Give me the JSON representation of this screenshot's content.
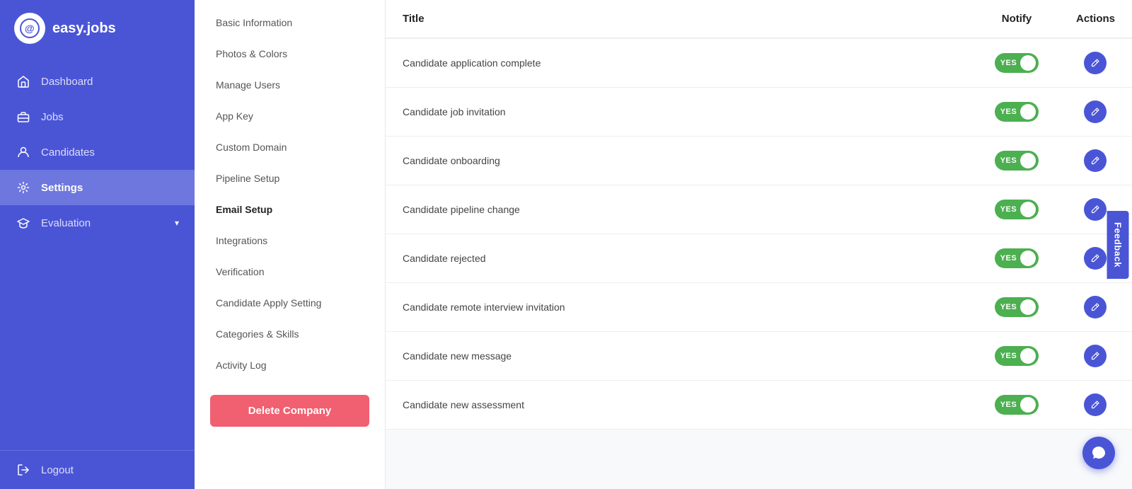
{
  "brand": {
    "logo_text": "easy.jobs",
    "logo_initial": "@"
  },
  "sidebar": {
    "items": [
      {
        "id": "dashboard",
        "label": "Dashboard",
        "icon": "home"
      },
      {
        "id": "jobs",
        "label": "Jobs",
        "icon": "briefcase"
      },
      {
        "id": "candidates",
        "label": "Candidates",
        "icon": "user"
      },
      {
        "id": "settings",
        "label": "Settings",
        "icon": "gear",
        "active": true
      },
      {
        "id": "evaluation",
        "label": "Evaluation",
        "icon": "graduation",
        "has_chevron": true
      }
    ],
    "logout_label": "Logout"
  },
  "submenu": {
    "items": [
      {
        "id": "basic-info",
        "label": "Basic Information"
      },
      {
        "id": "photos-colors",
        "label": "Photos & Colors"
      },
      {
        "id": "manage-users",
        "label": "Manage Users"
      },
      {
        "id": "app-key",
        "label": "App Key"
      },
      {
        "id": "custom-domain",
        "label": "Custom Domain"
      },
      {
        "id": "pipeline-setup",
        "label": "Pipeline Setup"
      },
      {
        "id": "email-setup",
        "label": "Email Setup",
        "active": true
      },
      {
        "id": "integrations",
        "label": "Integrations"
      },
      {
        "id": "verification",
        "label": "Verification"
      },
      {
        "id": "candidate-apply",
        "label": "Candidate Apply Setting"
      },
      {
        "id": "categories-skills",
        "label": "Categories & Skills"
      },
      {
        "id": "activity-log",
        "label": "Activity Log"
      }
    ],
    "delete_button_label": "Delete Company"
  },
  "table": {
    "headers": {
      "title": "Title",
      "notify": "Notify",
      "actions": "Actions"
    },
    "rows": [
      {
        "id": "row-1",
        "title": "Candidate application complete",
        "notify": true,
        "notify_label": "YES"
      },
      {
        "id": "row-2",
        "title": "Candidate job invitation",
        "notify": true,
        "notify_label": "YES"
      },
      {
        "id": "row-3",
        "title": "Candidate onboarding",
        "notify": true,
        "notify_label": "YES"
      },
      {
        "id": "row-4",
        "title": "Candidate pipeline change",
        "notify": true,
        "notify_label": "YES"
      },
      {
        "id": "row-5",
        "title": "Candidate rejected",
        "notify": true,
        "notify_label": "YES"
      },
      {
        "id": "row-6",
        "title": "Candidate remote interview invitation",
        "notify": true,
        "notify_label": "YES"
      },
      {
        "id": "row-7",
        "title": "Candidate new message",
        "notify": true,
        "notify_label": "YES"
      },
      {
        "id": "row-8",
        "title": "Candidate new assessment",
        "notify": true,
        "notify_label": "YES"
      }
    ]
  },
  "feedback": {
    "label": "Feedback"
  },
  "icons": {
    "home": "⌂",
    "briefcase": "💼",
    "user": "👤",
    "gear": "⚙",
    "graduation": "🎓",
    "logout": "↩",
    "pencil": "✏",
    "chat": "💬"
  }
}
